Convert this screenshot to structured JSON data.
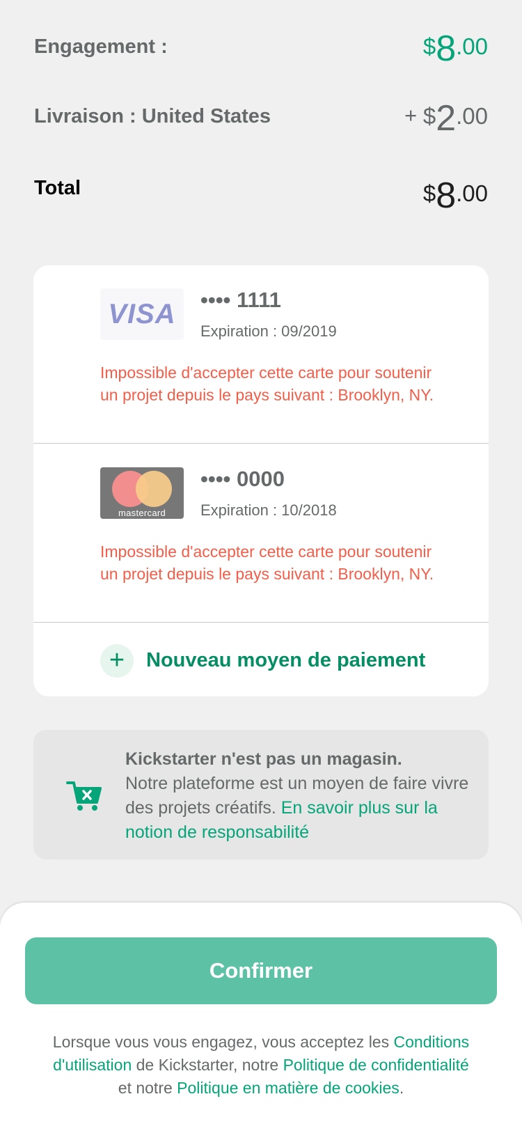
{
  "summary": {
    "pledge": {
      "label": "Engagement :",
      "currency": "$",
      "integer": "8",
      "decimals": ".00"
    },
    "shipping": {
      "label": "Livraison : United States",
      "prefix": "+ ",
      "currency": "$",
      "integer": "2",
      "decimals": ".00"
    },
    "total": {
      "label": "Total",
      "currency": "$",
      "integer": "8",
      "decimals": ".00"
    }
  },
  "payment_methods": [
    {
      "brand": "VISA",
      "number": "•••• 1111",
      "expiration": "Expiration : 09/2019",
      "error": "Impossible d'accepter cette carte pour soutenir un projet depuis le pays suivant : Brooklyn, NY."
    },
    {
      "brand": "mastercard",
      "number": "•••• 0000",
      "expiration": "Expiration : 10/2018",
      "error": "Impossible d'accepter cette carte pour soutenir un projet depuis le pays suivant : Brooklyn, NY."
    }
  ],
  "add_payment": {
    "icon": "+",
    "label": "Nouveau moyen de paiement"
  },
  "info": {
    "icon": "cart-x-icon",
    "title": "Kickstarter n'est pas un magasin.",
    "body": "Notre plateforme est un moyen de faire vivre des projets créatifs. ",
    "link": "En savoir plus sur la notion de responsabilité"
  },
  "confirm_label": "Confirmer",
  "legal": {
    "t1": "Lorsque vous vous engagez, vous acceptez les ",
    "link_terms": "Conditions d'utilisation",
    "t2": " de Kickstarter, notre ",
    "link_privacy": "Politique de confidentialité",
    "t3": " et notre ",
    "link_cookies": "Politique en matière de cookies",
    "t4": "."
  },
  "colors": {
    "accent": "#05a579",
    "accent_dark": "#058d63",
    "error": "#f25e49",
    "confirm_button": "#5dc2a5",
    "background": "#f0f0f0",
    "text": "#656969"
  }
}
